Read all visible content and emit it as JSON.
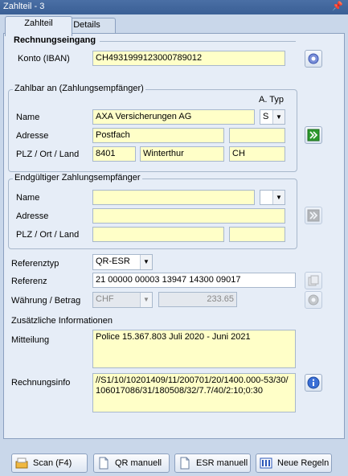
{
  "window": {
    "title": "Zahlteil - 3",
    "pin_glyph": "q"
  },
  "tabs": [
    {
      "label": "Zahlteil"
    },
    {
      "label": "Details"
    }
  ],
  "section_header": "Rechnungseingang",
  "konto": {
    "label": "Konto (IBAN)",
    "value": "CH4931999123000789012"
  },
  "zahlbar": {
    "title": "Zahlbar an (Zahlungsempfänger)",
    "typ_header": "A. Typ",
    "name_label": "Name",
    "name_value": "AXA Versicherungen AG",
    "typ_value": "S",
    "adresse_label": "Adresse",
    "adresse_value": "Postfach",
    "adresse2_value": "",
    "plz_label": "PLZ / Ort / Land",
    "plz_value": "8401",
    "ort_value": "Winterthur",
    "land_value": "CH"
  },
  "endgueltig": {
    "title": "Endgültiger Zahlungsempfänger",
    "name_label": "Name",
    "name_value": "",
    "adresse_label": "Adresse",
    "adresse_value": "",
    "plz_label": "PLZ / Ort / Land",
    "plz_value": "",
    "land_value": ""
  },
  "referenztyp": {
    "label": "Referenztyp",
    "value": "QR-ESR"
  },
  "referenz": {
    "label": "Referenz",
    "value": "21 00000 00003 13947 14300 09017"
  },
  "waehrung": {
    "label": "Währung / Betrag",
    "currency": "CHF",
    "betrag": "233.65"
  },
  "zusatz": {
    "title": "Zusätzliche Informationen",
    "mitteilung_label": "Mitteilung",
    "mitteilung_value": "Police 15.367.803 Juli 2020 - Juni 2021",
    "rechnungsinfo_label": "Rechnungsinfo",
    "rechnungsinfo_value": "//S1/10/10201409/11/200701/20/1400.000-53/30/106017086/31/180508/32/7.7/40/2:10;0:30"
  },
  "buttons": {
    "scan": "Scan (F4)",
    "qr": "QR manuell",
    "esr": "ESR manuell",
    "regeln": "Neue Regeln"
  },
  "colors": {
    "field_yellow": "#ffffc8",
    "panel": "#e6edf7",
    "frame": "#c9d7ea"
  }
}
